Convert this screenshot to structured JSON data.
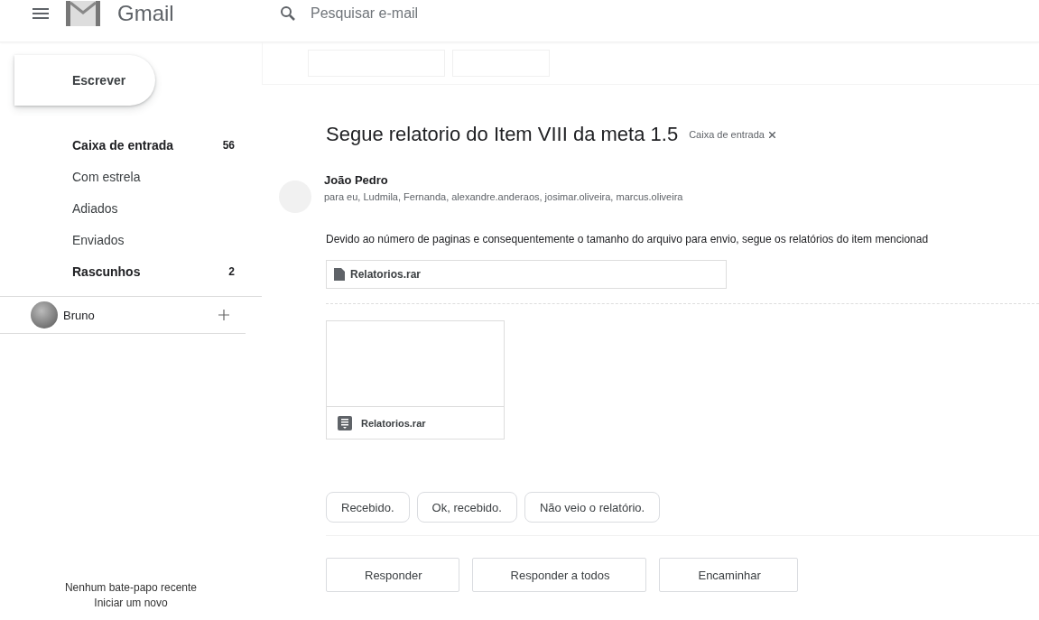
{
  "header": {
    "app_name": "Gmail",
    "search": {
      "placeholder": "Pesquisar e-mail"
    }
  },
  "sidebar": {
    "compose": "Escrever",
    "items": [
      {
        "label": "Caixa de entrada",
        "count": "56",
        "unread": true,
        "selected": false
      },
      {
        "label": "Com estrela",
        "unread": false,
        "selected": false
      },
      {
        "label": "Adiados",
        "unread": false,
        "selected": false
      },
      {
        "label": "Enviados",
        "unread": false,
        "selected": false
      },
      {
        "label": "Rascunhos",
        "count": "2",
        "unread": true,
        "selected": false
      }
    ],
    "chat": {
      "user": "Bruno",
      "empty_text": "Nenhum bate-papo recente",
      "start_link": "Iniciar um novo"
    }
  },
  "email": {
    "subject": "Segue relatorio do Item VIII da meta 1.5",
    "label_chip": "Caixa de entrada",
    "sender": "João Pedro",
    "recipients": "para eu, Ludmila, Fernanda, alexandre.anderaos, josimar.oliveira, marcus.oliveira",
    "body": "Devido ao número de paginas e consequentemente o tamanho do arquivo para envio, segue os relatórios do item mencionad",
    "link_attachment": "Relatorios.rar",
    "attachment": {
      "name": "Relatorios.rar"
    }
  },
  "smart_replies": [
    "Recebido.",
    "Ok, recebido.",
    "Não veio o relatório."
  ],
  "actions": [
    "Responder",
    "Responder a todos",
    "Encaminhar"
  ]
}
